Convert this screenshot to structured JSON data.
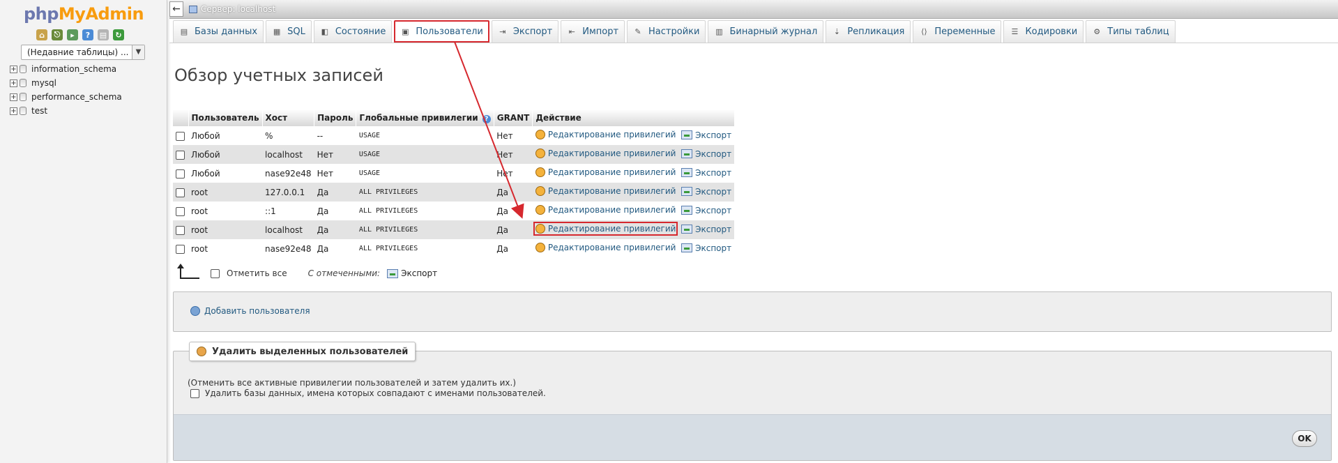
{
  "app": {
    "logo_part1": "php",
    "logo_part2": "MyAdmin",
    "recent_tables": "(Недавние таблицы) ...",
    "databases": [
      "information_schema",
      "mysql",
      "performance_schema",
      "test"
    ]
  },
  "topbar": {
    "back_symbol": "←",
    "server_label": "Сервер: localhost"
  },
  "tabs": [
    {
      "label": "Базы данных",
      "icon": "database-icon"
    },
    {
      "label": "SQL",
      "icon": "sql-icon"
    },
    {
      "label": "Состояние",
      "icon": "status-icon"
    },
    {
      "label": "Пользователи",
      "icon": "users-icon",
      "active": true
    },
    {
      "label": "Экспорт",
      "icon": "export-icon"
    },
    {
      "label": "Импорт",
      "icon": "import-icon"
    },
    {
      "label": "Настройки",
      "icon": "wrench-icon"
    },
    {
      "label": "Бинарный журнал",
      "icon": "binlog-icon"
    },
    {
      "label": "Репликация",
      "icon": "replication-icon"
    },
    {
      "label": "Переменные",
      "icon": "variables-icon"
    },
    {
      "label": "Кодировки",
      "icon": "charset-icon"
    },
    {
      "label": "Типы таблиц",
      "icon": "engines-icon"
    }
  ],
  "main": {
    "title": "Обзор учетных записей",
    "columns": [
      "Пользователь",
      "Хост",
      "Пароль",
      "Глобальные привилегии",
      "GRANT",
      "Действие"
    ],
    "rows": [
      {
        "user": "Любой",
        "host": "%",
        "password": "--",
        "privileges": "USAGE",
        "grant": "Нет",
        "any": true,
        "no_pass": false
      },
      {
        "user": "Любой",
        "host": "localhost",
        "password": "Нет",
        "privileges": "USAGE",
        "grant": "Нет",
        "any": true,
        "no_pass": true
      },
      {
        "user": "Любой",
        "host": "nase92e48",
        "password": "Нет",
        "privileges": "USAGE",
        "grant": "Нет",
        "any": true,
        "no_pass": true
      },
      {
        "user": "root",
        "host": "127.0.0.1",
        "password": "Да",
        "privileges": "ALL PRIVILEGES",
        "grant": "Да",
        "any": false,
        "no_pass": false
      },
      {
        "user": "root",
        "host": "::1",
        "password": "Да",
        "privileges": "ALL PRIVILEGES",
        "grant": "Да",
        "any": false,
        "no_pass": false
      },
      {
        "user": "root",
        "host": "localhost",
        "password": "Да",
        "privileges": "ALL PRIVILEGES",
        "grant": "Да",
        "any": false,
        "no_pass": false,
        "highlight": true
      },
      {
        "user": "root",
        "host": "nase92e48",
        "password": "Да",
        "privileges": "ALL PRIVILEGES",
        "grant": "Да",
        "any": false,
        "no_pass": false
      }
    ],
    "edit_label": "Редактирование привилегий",
    "export_label": "Экспорт",
    "check_all": "Отметить все",
    "with_selected": "С отмеченными:",
    "bulk_export": "Экспорт",
    "add_user": "Добавить пользователя",
    "delete_legend": "Удалить выделенных пользователей",
    "delete_note": "(Отменить все активные привилегии пользователей и затем удалить их.)",
    "drop_db_label": "Удалить базы данных, имена которых совпадают с именами пользователей.",
    "ok_label": "OK"
  },
  "colors": {
    "accent_red": "#d6282e",
    "link_blue": "#235a81",
    "logo_blue": "#6c78af",
    "logo_orange": "#f89c0e"
  }
}
